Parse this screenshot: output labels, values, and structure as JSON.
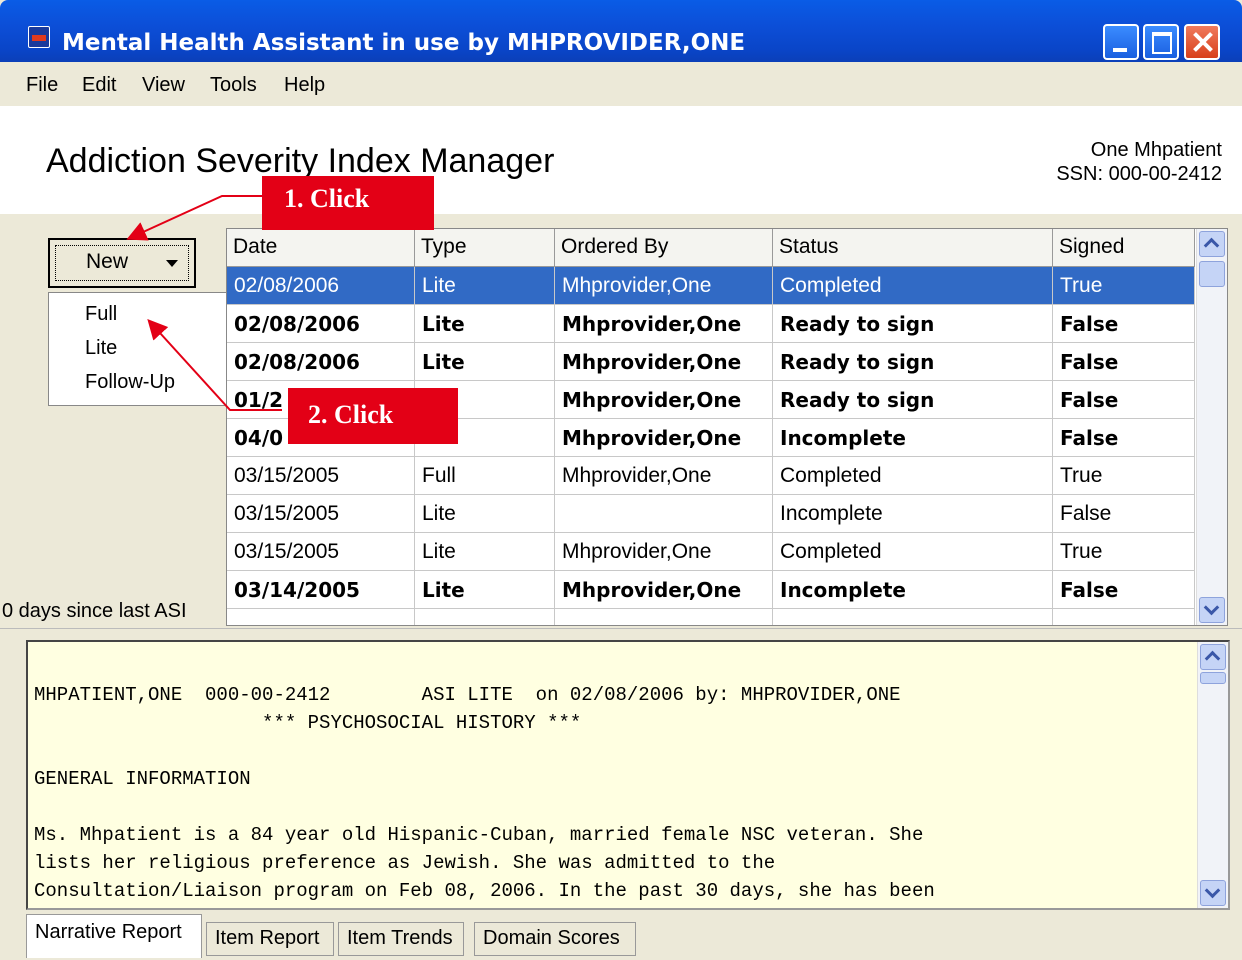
{
  "window": {
    "title": "Mental Health Assistant in use by MHPROVIDER,ONE"
  },
  "menu": [
    "File",
    "Edit",
    "View",
    "Tools",
    "Help"
  ],
  "header": {
    "title": "Addiction Severity Index Manager",
    "patient_name": "One Mhpatient",
    "patient_ssn": "SSN: 000-00-2412"
  },
  "new_button": {
    "label": "New",
    "options": [
      "Full",
      "Lite",
      "Follow-Up"
    ]
  },
  "days_since": "0 days since last ASI",
  "grid": {
    "columns": [
      "Date",
      "Type",
      "Ordered By",
      "Status",
      "Signed"
    ],
    "rows": [
      {
        "date": "02/08/2006",
        "type": "Lite",
        "ordered_by": "Mhprovider,One",
        "status": "Completed",
        "signed": "True",
        "style": "selected"
      },
      {
        "date": "02/08/2006",
        "type": "Lite",
        "ordered_by": "Mhprovider,One",
        "status": "Ready to sign",
        "signed": "False",
        "style": "bold"
      },
      {
        "date": "02/08/2006",
        "type": "Lite",
        "ordered_by": "Mhprovider,One",
        "status": "Ready to sign",
        "signed": "False",
        "style": "bold"
      },
      {
        "date": "01/2",
        "type": "",
        "ordered_by": "Mhprovider,One",
        "status": "Ready to sign",
        "signed": "False",
        "style": "bold"
      },
      {
        "date": "04/0",
        "type": "",
        "ordered_by": "Mhprovider,One",
        "status": "Incomplete",
        "signed": "False",
        "style": "bold"
      },
      {
        "date": "03/15/2005",
        "type": "Full",
        "ordered_by": "Mhprovider,One",
        "status": "Completed",
        "signed": "True",
        "style": "normal"
      },
      {
        "date": "03/15/2005",
        "type": "Lite",
        "ordered_by": "",
        "status": "Incomplete",
        "signed": "False",
        "style": "normal"
      },
      {
        "date": "03/15/2005",
        "type": "Lite",
        "ordered_by": "Mhprovider,One",
        "status": "Completed",
        "signed": "True",
        "style": "normal"
      },
      {
        "date": "03/14/2005",
        "type": "Lite",
        "ordered_by": "Mhprovider,One",
        "status": "Incomplete",
        "signed": "False",
        "style": "bold"
      }
    ]
  },
  "report": {
    "lines": [
      "MHPATIENT,ONE  000-00-2412        ASI LITE  on 02/08/2006 by: MHPROVIDER,ONE",
      "                    *** PSYCHOSOCIAL HISTORY ***",
      "",
      "GENERAL INFORMATION",
      "",
      "Ms. Mhpatient is a 84 year old Hispanic-Cuban, married female NSC veteran. She",
      "lists her religious preference as Jewish. She was admitted to the",
      "Consultation/Liaison program on Feb 08, 2006. In the past 30 days, she has been"
    ]
  },
  "tabs": [
    "Narrative Report",
    "Item Report",
    "Item Trends",
    "Domain Scores"
  ],
  "callouts": {
    "first": "1. Click",
    "second": "2. Click"
  },
  "colors": {
    "selection": "#316ac5",
    "callout": "#e30016",
    "report_bg": "#ffffe1",
    "titlebar": "#0a5ce6"
  }
}
